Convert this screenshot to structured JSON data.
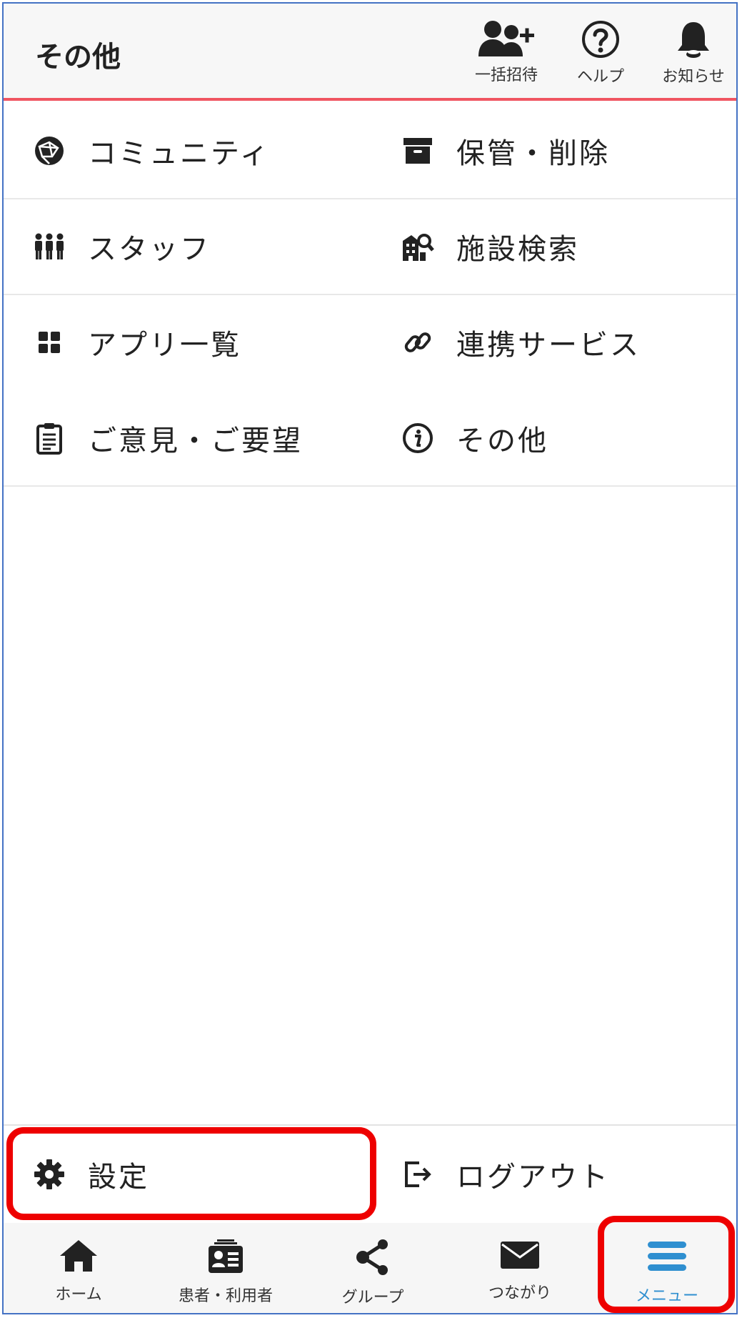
{
  "header": {
    "title": "その他",
    "actions": [
      {
        "label": "一括招待",
        "icon": "invite-users-icon"
      },
      {
        "label": "ヘルプ",
        "icon": "help-icon"
      },
      {
        "label": "お知らせ",
        "icon": "bell-icon"
      }
    ]
  },
  "menu": {
    "items": [
      {
        "label": "コミュニティ",
        "icon": "globe-icon"
      },
      {
        "label": "保管・削除",
        "icon": "archive-icon"
      },
      {
        "label": "スタッフ",
        "icon": "staff-icon"
      },
      {
        "label": "施設検索",
        "icon": "facility-search-icon"
      },
      {
        "label": "アプリ一覧",
        "icon": "apps-grid-icon"
      },
      {
        "label": "連携サービス",
        "icon": "link-icon"
      },
      {
        "label": "ご意見・ご要望",
        "icon": "clipboard-icon"
      },
      {
        "label": "その他",
        "icon": "info-icon"
      }
    ]
  },
  "bottom_actions": {
    "settings": {
      "label": "設定",
      "icon": "gear-icon"
    },
    "logout": {
      "label": "ログアウト",
      "icon": "logout-icon"
    }
  },
  "nav": {
    "items": [
      {
        "label": "ホーム",
        "icon": "home-icon"
      },
      {
        "label": "患者・利用者",
        "icon": "id-card-icon"
      },
      {
        "label": "グループ",
        "icon": "share-icon"
      },
      {
        "label": "つながり",
        "icon": "envelope-icon"
      },
      {
        "label": "メニュー",
        "icon": "hamburger-icon"
      }
    ],
    "active_index": 4,
    "active_color": "#2f8fd0"
  },
  "colors": {
    "header_accent": "#f05561",
    "highlight": "#ee0000",
    "frame_border": "#4472c4"
  }
}
